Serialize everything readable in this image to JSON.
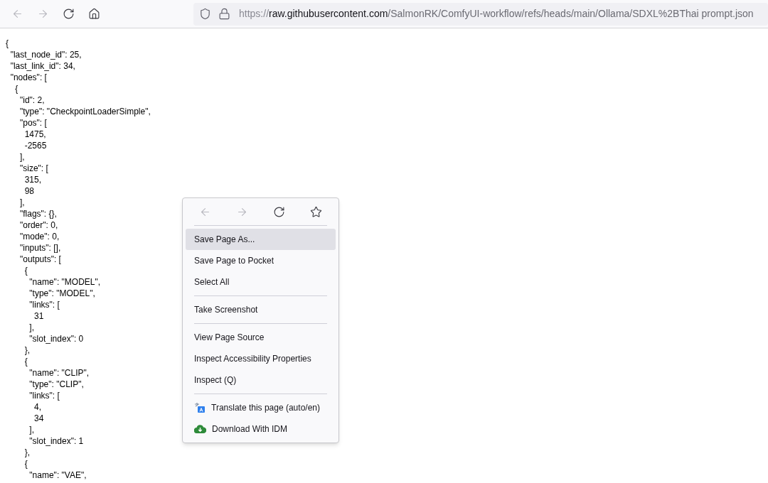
{
  "toolbar": {
    "nav_buttons": [
      {
        "kind": "back",
        "disabled": true
      },
      {
        "kind": "forward",
        "disabled": true
      },
      {
        "kind": "reload",
        "disabled": false
      },
      {
        "kind": "home",
        "disabled": false
      }
    ],
    "url": {
      "scheme": "https://",
      "host": "raw.githubusercontent.com",
      "path": "/SalmonRK/ComfyUI-workflow/refs/heads/main/Ollama/SDXL%2BThai prompt.json"
    }
  },
  "document": {
    "lines": [
      "{",
      "  \"last_node_id\": 25,",
      "  \"last_link_id\": 34,",
      "  \"nodes\": [",
      "    {",
      "      \"id\": 2,",
      "      \"type\": \"CheckpointLoaderSimple\",",
      "      \"pos\": [",
      "        1475,",
      "        -2565",
      "      ],",
      "      \"size\": [",
      "        315,",
      "        98",
      "      ],",
      "      \"flags\": {},",
      "      \"order\": 0,",
      "      \"mode\": 0,",
      "      \"inputs\": [],",
      "      \"outputs\": [",
      "        {",
      "          \"name\": \"MODEL\",",
      "          \"type\": \"MODEL\",",
      "          \"links\": [",
      "            31",
      "          ],",
      "          \"slot_index\": 0",
      "        },",
      "        {",
      "          \"name\": \"CLIP\",",
      "          \"type\": \"CLIP\",",
      "          \"links\": [",
      "            4,",
      "            34",
      "          ],",
      "          \"slot_index\": 1",
      "        },",
      "        {",
      "          \"name\": \"VAE\","
    ]
  },
  "context_menu": {
    "nav_buttons": [
      {
        "kind": "back",
        "disabled": true
      },
      {
        "kind": "forward",
        "disabled": true
      },
      {
        "kind": "reload",
        "disabled": false
      },
      {
        "kind": "bookmark",
        "disabled": false
      }
    ],
    "groups": [
      [
        {
          "label": "Save Page As...",
          "selected": true
        },
        {
          "label": "Save Page to Pocket",
          "selected": false
        },
        {
          "label": "Select All",
          "selected": false
        }
      ],
      [
        {
          "label": "Take Screenshot",
          "selected": false
        }
      ],
      [
        {
          "label": "View Page Source",
          "selected": false
        },
        {
          "label": "Inspect Accessibility Properties",
          "selected": false
        },
        {
          "label": "Inspect (Q)",
          "selected": false
        }
      ],
      [
        {
          "label": "Translate this page (auto/en)",
          "selected": false,
          "kind": "translate"
        },
        {
          "label": "Download With IDM",
          "selected": false,
          "kind": "download"
        }
      ]
    ]
  }
}
